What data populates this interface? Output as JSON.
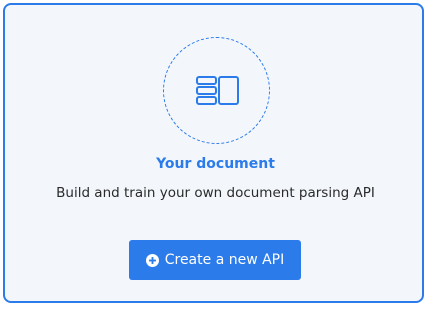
{
  "card": {
    "title": "Your document",
    "description": "Build and train your own document parsing API",
    "icon": "document-layout-icon"
  },
  "actions": {
    "create_label": "Create a new API",
    "create_icon": "plus-circle-icon"
  },
  "colors": {
    "accent": "#2b7bea",
    "card_background": "#f3f7fc",
    "text": "#2a2a2a"
  }
}
